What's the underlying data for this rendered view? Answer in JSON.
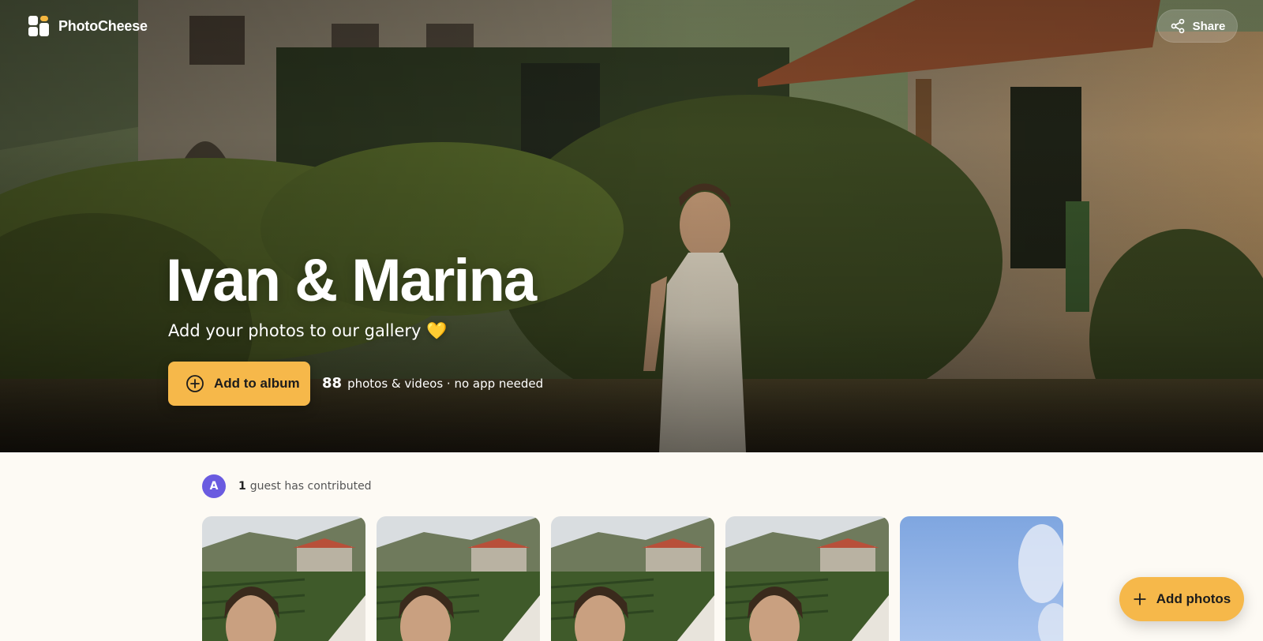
{
  "brand": {
    "name": "PhotoCheese",
    "logo_icon": "photocheese-logo-icon"
  },
  "header": {
    "share_label": "Share",
    "share_icon": "share-icon"
  },
  "hero": {
    "title": "Ivan & Marina",
    "subtitle": "Add your photos to our gallery 💛",
    "add_button_label": "Add to album",
    "add_button_icon": "plus-circle-icon",
    "stats_count": "88",
    "stats_text": "photos & videos · no app needed"
  },
  "contributors": {
    "avatar_initial": "A",
    "avatar_color": "#6a5be0",
    "count": "1",
    "text": "guest has contributed"
  },
  "gallery": {
    "items": [
      {
        "kind": "portrait-vineyard"
      },
      {
        "kind": "portrait-vineyard"
      },
      {
        "kind": "portrait-vineyard"
      },
      {
        "kind": "portrait-vineyard"
      },
      {
        "kind": "sky-portrait"
      }
    ]
  },
  "fab": {
    "label": "Add photos",
    "icon": "plus-icon"
  },
  "colors": {
    "accent": "#f6b84a",
    "background": "#fdfaf4"
  }
}
